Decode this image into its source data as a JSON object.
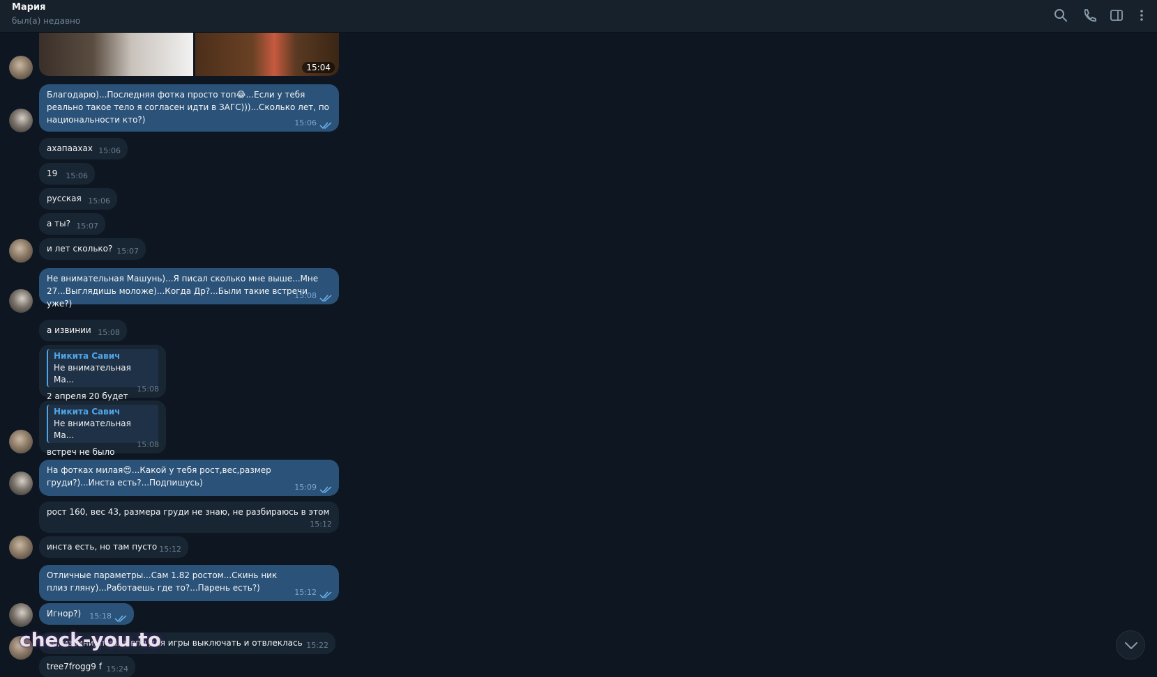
{
  "header": {
    "name": "Мария",
    "status": "был(а) недавно"
  },
  "media": {
    "time": "15:04"
  },
  "messages": [
    {
      "dir": "out",
      "text": "Благодарю)...Последняя фотка просто топ😂...Если у тебя реально такое тело я согласен идти в ЗАГС)))...Сколько лет, по национальности кто?)",
      "time": "15:06"
    },
    {
      "dir": "in",
      "text": "ахапаахах",
      "time": "15:06"
    },
    {
      "dir": "in",
      "text": "19",
      "time": "15:06"
    },
    {
      "dir": "in",
      "text": "русская",
      "time": "15:06"
    },
    {
      "dir": "in",
      "text": "а ты?",
      "time": "15:07"
    },
    {
      "dir": "in",
      "text": "и лет сколько?",
      "time": "15:07"
    },
    {
      "dir": "out",
      "text": "Не внимательная Машунь)...Я писал сколько мне выше...Мне 27...Выглядишь моложе)...Когда Др?...Были такие встречи уже?)",
      "time": "15:08"
    },
    {
      "dir": "in",
      "text": "а извинии",
      "time": "15:08"
    },
    {
      "dir": "in",
      "reply_name": "Никита Савич",
      "reply_text": "Не внимательная Ма...",
      "text": "2 апреля 20 будет",
      "time": "15:08"
    },
    {
      "dir": "in",
      "reply_name": "Никита Савич",
      "reply_text": "Не внимательная Ма...",
      "text": "встреч не было",
      "time": "15:08"
    },
    {
      "dir": "out",
      "text": "На фотках милая😍...Какой у тебя рост,вес,размер груди?)...Инста есть?...Подпишусь)",
      "time": "15:09"
    },
    {
      "dir": "in",
      "text": "рост 160, вес 43, размера груди не знаю, не разбираюсь в этом",
      "time": "15:12"
    },
    {
      "dir": "in",
      "text": "инста есть, но там пусто",
      "time": "15:12"
    },
    {
      "dir": "out",
      "text": "Отличные параметры...Сам 1.82 ростом...Скинь ник плиз гляну)...Работаешь где то?...Парень есть?)",
      "time": "15:12"
    },
    {
      "dir": "out",
      "text": "Игнор?)",
      "time": "15:18"
    },
    {
      "dir": "in",
      "text": "не, извини, пошла впн для игры выключать и отвлеклась",
      "time": "15:22"
    },
    {
      "dir": "in",
      "text": "tree7frogg9 f",
      "time": "15:24"
    }
  ],
  "watermark": "check-you.to",
  "colors": {
    "background": "#0e1621",
    "header": "#17212b",
    "bubble_in": "#182533",
    "bubble_out": "#2b5278",
    "accent": "#4fa6e8"
  },
  "icons": [
    "search-icon",
    "phone-icon",
    "sidebar-toggle-icon",
    "more-vertical-icon",
    "chevron-down-icon",
    "double-check-icon"
  ]
}
